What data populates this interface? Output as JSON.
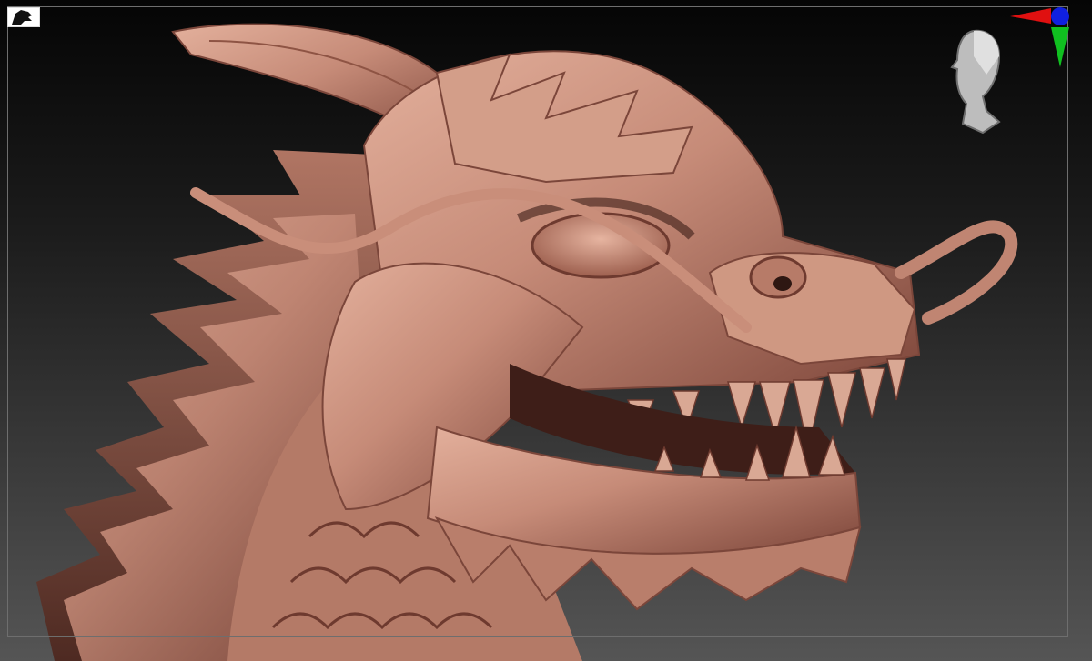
{
  "viewport": {
    "background_top": "#050505",
    "background_bottom": "#555555",
    "frame_color": "#6e6e6e",
    "model_base_color": "#c68b78",
    "model_shadow_color": "#5a2f26",
    "model_highlight_color": "#e7b7a4"
  },
  "icons": {
    "corner": "dragon-silhouette-icon",
    "navigator": "head-navigator-icon",
    "axis": "xyz-axis-gizmo-icon"
  },
  "axis_colors": {
    "x": "#e01010",
    "y": "#10c020",
    "z": "#1020e0"
  }
}
